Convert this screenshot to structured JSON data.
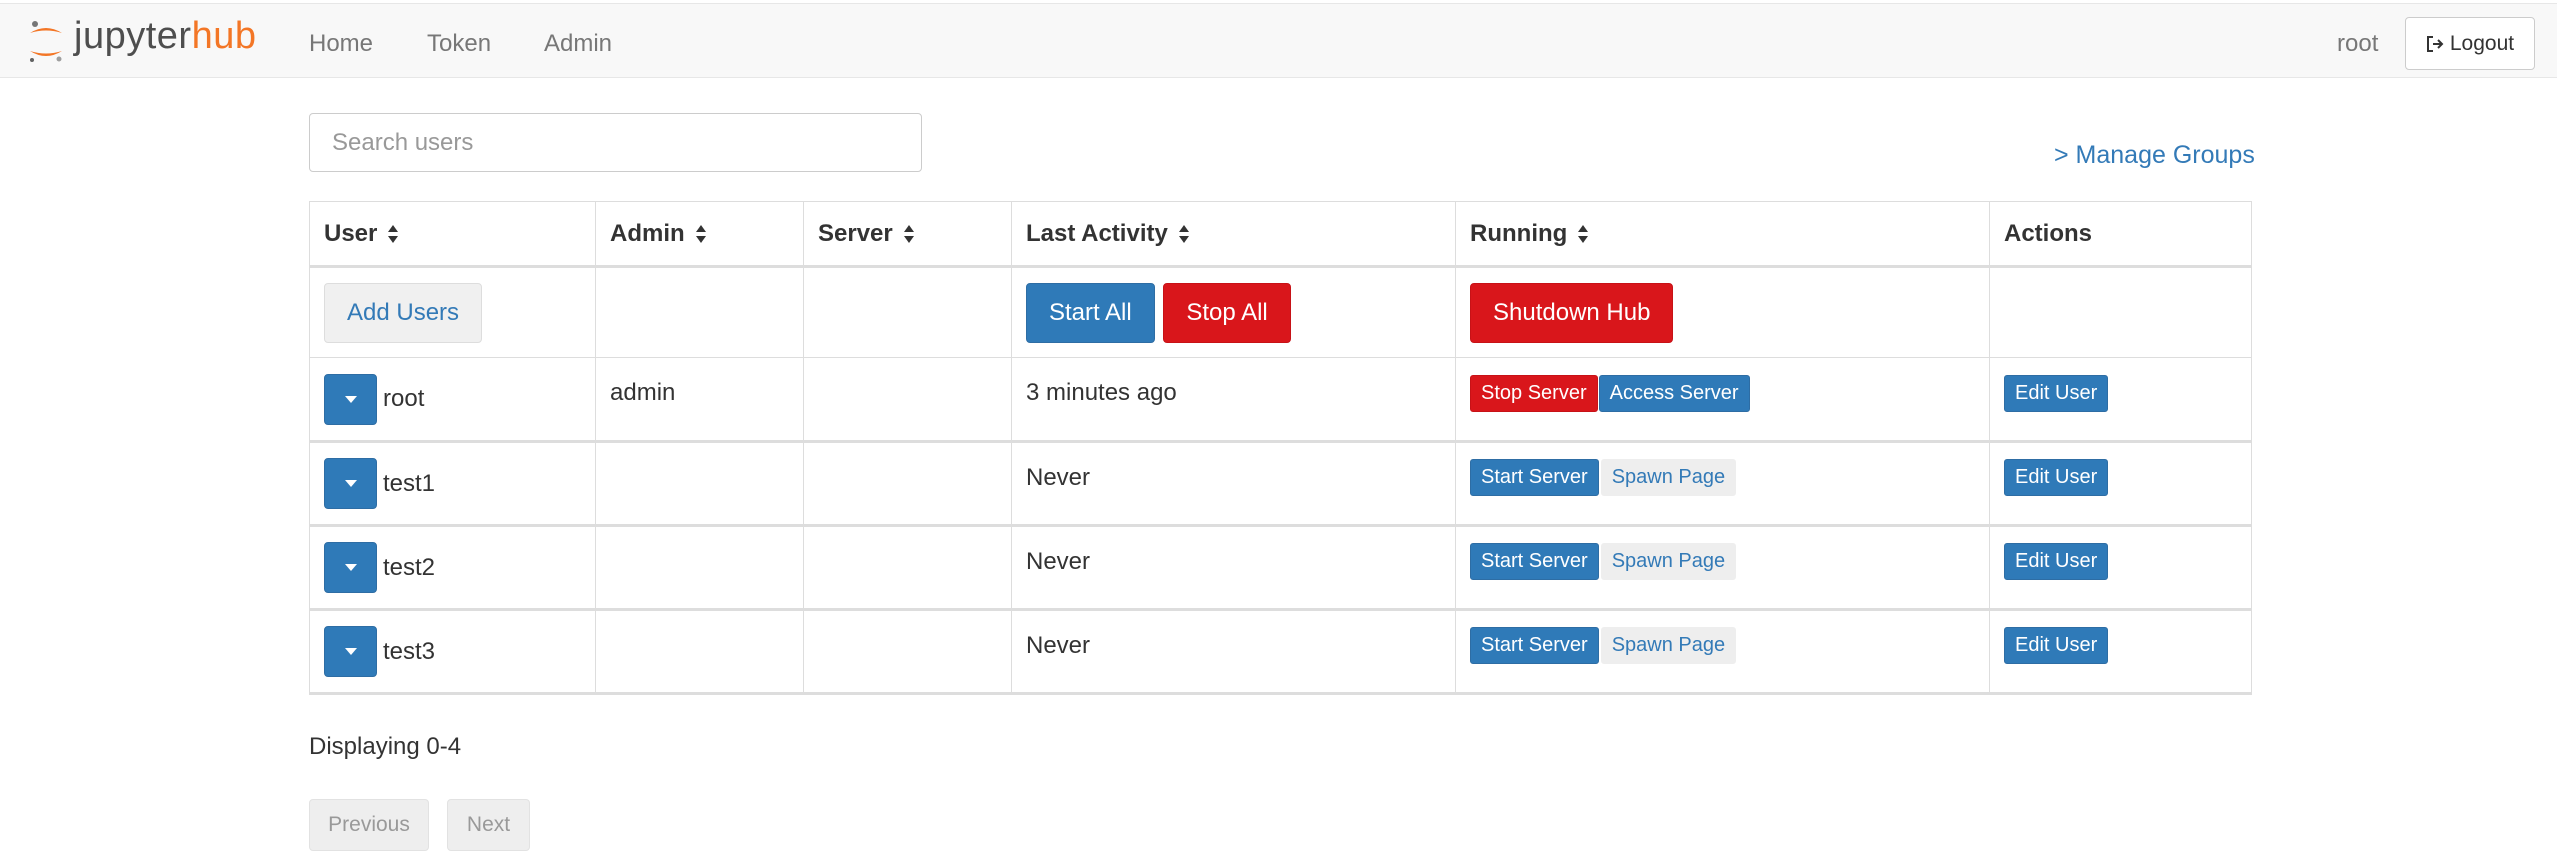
{
  "brand": {
    "name_part1": "jupyter",
    "name_part2": "hub",
    "accent_color": "#f37626"
  },
  "nav": {
    "links": [
      "Home",
      "Token",
      "Admin"
    ],
    "user": "root",
    "logout_label": "Logout",
    "logout_icon": "sign-out-icon"
  },
  "search": {
    "placeholder": "Search users",
    "value": ""
  },
  "manage_groups_label": "> Manage Groups",
  "table": {
    "headers": [
      "User",
      "Admin",
      "Server",
      "Last Activity",
      "Running",
      "Actions"
    ],
    "sortable": [
      true,
      true,
      true,
      true,
      true,
      false
    ],
    "controls": {
      "add_users": "Add Users",
      "start_all": "Start All",
      "stop_all": "Stop All",
      "shutdown_hub": "Shutdown Hub"
    },
    "rows": [
      {
        "user": "root",
        "admin": "admin",
        "server": "",
        "last_activity": "3 minutes ago",
        "running": true,
        "primary_action": "Stop Server",
        "secondary_action": "Access Server",
        "edit": "Edit User"
      },
      {
        "user": "test1",
        "admin": "",
        "server": "",
        "last_activity": "Never",
        "running": false,
        "primary_action": "Start Server",
        "secondary_action": "Spawn Page",
        "edit": "Edit User"
      },
      {
        "user": "test2",
        "admin": "",
        "server": "",
        "last_activity": "Never",
        "running": false,
        "primary_action": "Start Server",
        "secondary_action": "Spawn Page",
        "edit": "Edit User"
      },
      {
        "user": "test3",
        "admin": "",
        "server": "",
        "last_activity": "Never",
        "running": false,
        "primary_action": "Start Server",
        "secondary_action": "Spawn Page",
        "edit": "Edit User"
      }
    ]
  },
  "footer": {
    "displaying": "Displaying 0-4",
    "previous": "Previous",
    "next": "Next"
  },
  "colors": {
    "primary": "#2f7ab8",
    "danger": "#d9161b",
    "link": "#337ab7"
  }
}
